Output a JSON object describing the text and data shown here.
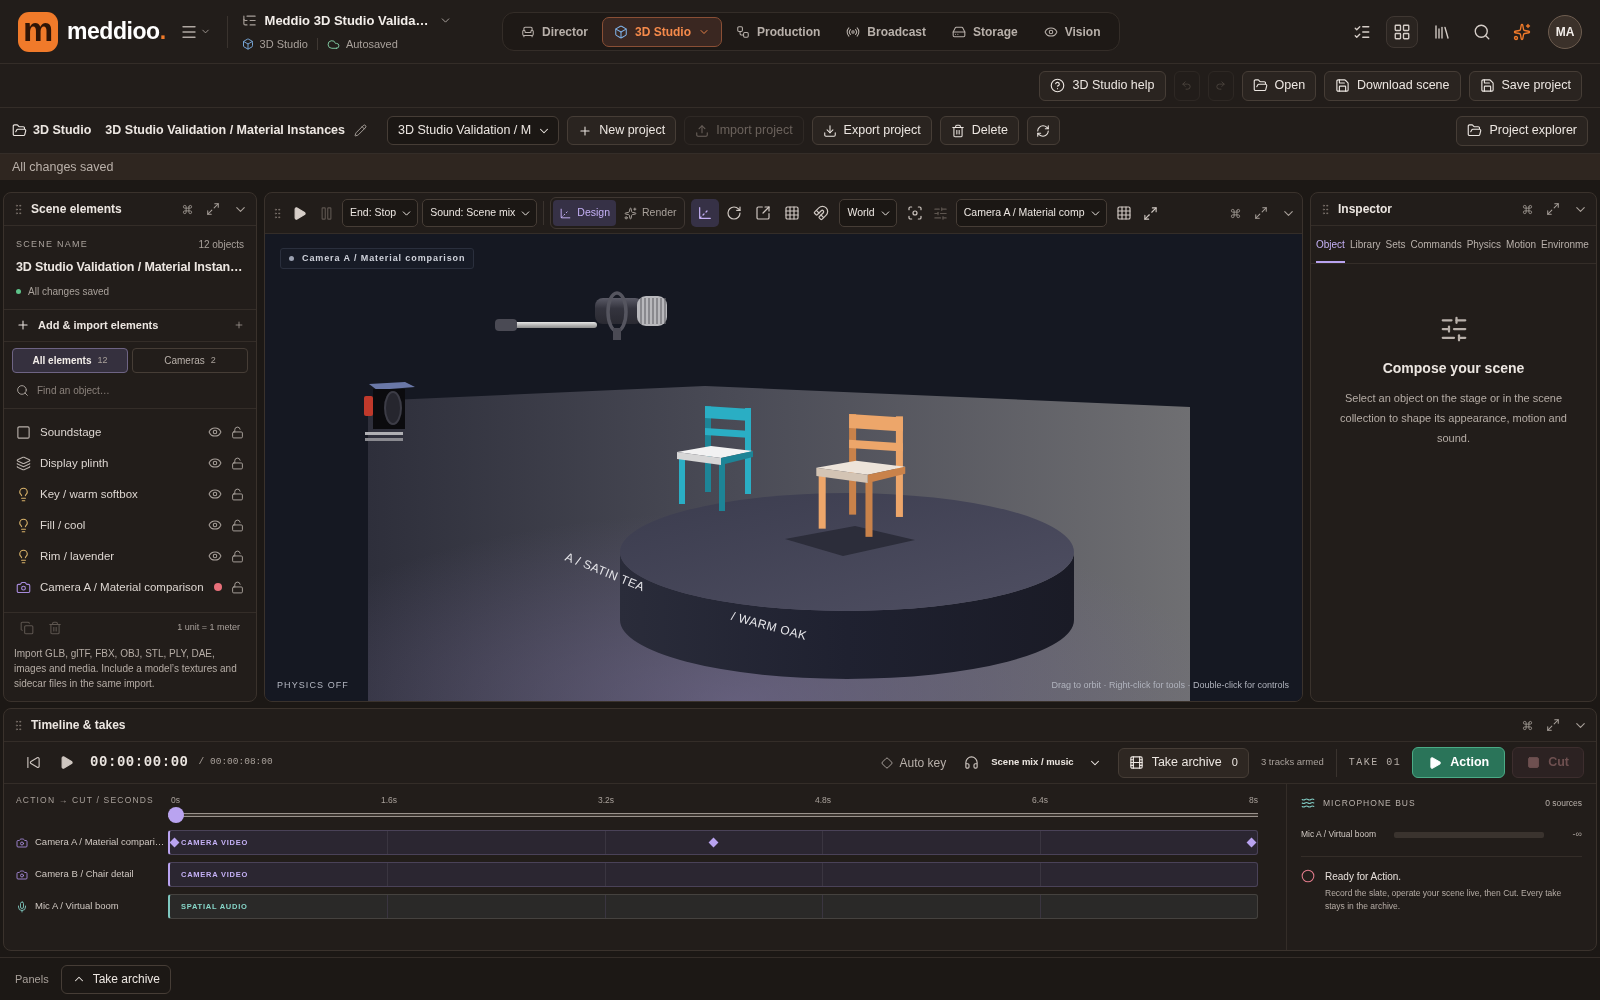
{
  "header": {
    "logo": {
      "letter": "m",
      "name": "meddioo",
      "accent": "."
    },
    "project": {
      "title": "Meddio 3D Studio Valida…",
      "module": "3D Studio",
      "save_state": "Autosaved"
    },
    "nav": [
      {
        "kind": "director",
        "label": "Director",
        "selected": false
      },
      {
        "kind": "studio",
        "label": "3D Studio",
        "selected": true
      },
      {
        "kind": "production",
        "label": "Production",
        "selected": false
      },
      {
        "kind": "broadcast",
        "label": "Broadcast",
        "selected": false
      },
      {
        "kind": "storage",
        "label": "Storage",
        "selected": false
      },
      {
        "kind": "vision",
        "label": "Vision",
        "selected": false
      }
    ],
    "tools": [
      {
        "kind": "checklist"
      },
      {
        "kind": "apps"
      },
      {
        "kind": "library"
      },
      {
        "kind": "search"
      },
      {
        "kind": "assistant"
      }
    ],
    "avatar": "MA"
  },
  "actions": {
    "help": "3D Studio help",
    "undo": {
      "disabled": true
    },
    "redo": {
      "disabled": true
    },
    "buttons": [
      {
        "kind": "open",
        "label": "Open"
      },
      {
        "kind": "download",
        "label": "Download scene"
      },
      {
        "kind": "save",
        "label": "Save project"
      }
    ]
  },
  "project_bar": {
    "section": "3D Studio",
    "title": "3D Studio Validation / Material Instances",
    "select": "3D Studio Validation / M",
    "buttons": [
      {
        "kind": "new",
        "label": "New project",
        "disabled": false
      },
      {
        "kind": "import",
        "label": "Import project",
        "disabled": true
      },
      {
        "kind": "export",
        "label": "Export project",
        "disabled": false
      },
      {
        "kind": "delete",
        "label": "Delete",
        "disabled": false
      }
    ],
    "explorer": "Project explorer"
  },
  "status": "All changes saved",
  "scene_panel": {
    "title": "Scene elements",
    "label": "SCENE NAME",
    "count": "12 objects",
    "name": "3D Studio Validation / Material Instan…",
    "saved": "All changes saved",
    "add": "Add & import elements",
    "filters": [
      {
        "label": "All elements",
        "count": "12",
        "selected": true
      },
      {
        "label": "Cameras",
        "count": "2",
        "selected": false
      }
    ],
    "search": {
      "placeholder": "Find an object…"
    },
    "items": [
      {
        "kind": "stage",
        "name": "Soundstage",
        "live": false
      },
      {
        "kind": "mesh",
        "name": "Display plinth",
        "live": false
      },
      {
        "kind": "light",
        "name": "Key / warm softbox",
        "live": false
      },
      {
        "kind": "light",
        "name": "Fill / cool",
        "live": false
      },
      {
        "kind": "light",
        "name": "Rim / lavender",
        "live": false
      },
      {
        "kind": "camera",
        "name": "Camera A / Material comparison",
        "live": true
      }
    ],
    "tools": [
      {
        "kind": "duplicate",
        "disabled": true
      },
      {
        "kind": "delete",
        "disabled": true
      }
    ],
    "scale": "1 unit = 1 meter",
    "help": "Import GLB, glTF, FBX, OBJ, STL, PLY, DAE, images and media. Include a model’s textures and sidecar files in the same import."
  },
  "viewport": {
    "pause": {
      "disabled": true
    },
    "end": "End: Stop",
    "sound": "Sound: Scene mix",
    "modes": [
      {
        "kind": "design",
        "label": "Design",
        "selected": true
      },
      {
        "kind": "render",
        "label": "Render",
        "selected": false
      }
    ],
    "tools": [
      {
        "kind": "axis",
        "selected": true
      },
      {
        "kind": "rotate",
        "selected": false
      },
      {
        "kind": "scale",
        "selected": false
      },
      {
        "kind": "grid",
        "selected": false
      },
      {
        "kind": "snap",
        "selected": false
      }
    ],
    "space": "World",
    "sliders": {
      "disabled": true
    },
    "camera": "Camera A / Material comp",
    "badge": "Camera A / Material comparison",
    "plinth_labels": [
      "A / SATIN TEA",
      "/ WARM OAK"
    ],
    "physics": "PHYSICS OFF",
    "hint": "Drag to orbit · Right-click for tools · Double-click for controls"
  },
  "inspector": {
    "title": "Inspector",
    "tabs": [
      {
        "label": "Object",
        "selected": true
      },
      {
        "label": "Library",
        "selected": false
      },
      {
        "label": "Sets",
        "selected": false
      },
      {
        "label": "Commands",
        "selected": false
      },
      {
        "label": "Physics",
        "selected": false
      },
      {
        "label": "Motion",
        "selected": false
      },
      {
        "label": "Environme",
        "selected": false
      }
    ],
    "empty_title": "Compose your scene",
    "empty_text": "Select an object on the stage or in the scene collection to shape its appearance, motion and sound."
  },
  "timeline": {
    "title": "Timeline & takes",
    "timecode": "00:00:00:00",
    "duration": "/ 00:00:08:00",
    "auto_key": "Auto key",
    "audio": "Scene mix / music",
    "archive": {
      "label": "Take archive",
      "count": "0"
    },
    "armed": "3 tracks armed",
    "take": "TAKE 01",
    "action": "Action",
    "cut": {
      "label": "Cut",
      "disabled": true
    },
    "heading": "ACTION → CUT / SECONDS",
    "ticks": [
      "0s",
      "1.6s",
      "3.2s",
      "4.8s",
      "6.4s",
      "8s"
    ],
    "playhead": {
      "level": 0
    },
    "tracks": [
      {
        "kind": "camera",
        "name": "Camera A / Material compari…",
        "clip": "CAMERA VIDEO",
        "keys": [
          {
            "level": 0
          },
          {
            "level": 0.5
          },
          {
            "level": 1
          }
        ]
      },
      {
        "kind": "camera",
        "name": "Camera B / Chair detail",
        "clip": "CAMERA VIDEO"
      },
      {
        "kind": "mic",
        "name": "Mic A / Virtual boom",
        "clip": "SPATIAL AUDIO"
      }
    ],
    "bus": {
      "title": "MICROPHONE BUS",
      "count": "0 sources",
      "inputs": [
        {
          "name": "Mic A / Virtual boom",
          "level": 0,
          "reading": "-∞"
        }
      ],
      "status": "Ready for Action.",
      "text": "Record the slate, operate your scene live, then Cut. Every take stays in the archive."
    }
  },
  "footer": {
    "label": "Panels",
    "button": "Take archive"
  }
}
